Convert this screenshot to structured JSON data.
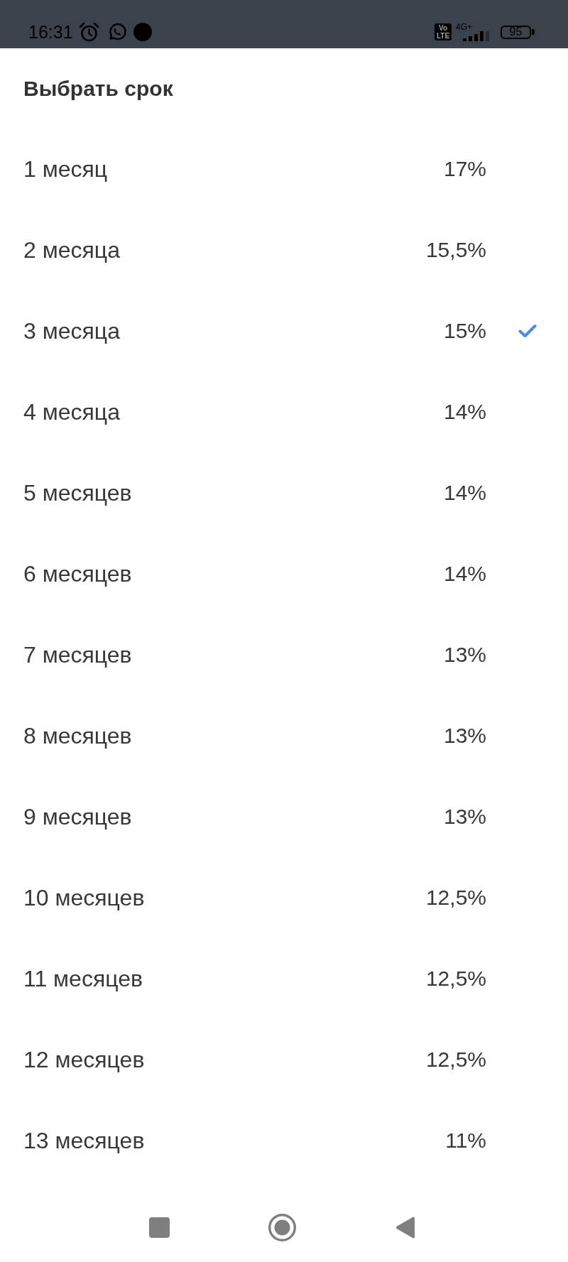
{
  "status_bar": {
    "time": "16:31",
    "volte_badge": "Vo LTE",
    "network_type": "4G+",
    "battery": "95"
  },
  "dialog": {
    "title": "Выбрать срок",
    "options": [
      {
        "label": "1 месяц",
        "rate": "17%",
        "selected": false
      },
      {
        "label": "2 месяца",
        "rate": "15,5%",
        "selected": false
      },
      {
        "label": "3 месяца",
        "rate": "15%",
        "selected": true
      },
      {
        "label": "4 месяца",
        "rate": "14%",
        "selected": false
      },
      {
        "label": "5 месяцев",
        "rate": "14%",
        "selected": false
      },
      {
        "label": "6 месяцев",
        "rate": "14%",
        "selected": false
      },
      {
        "label": "7 месяцев",
        "rate": "13%",
        "selected": false
      },
      {
        "label": "8 месяцев",
        "rate": "13%",
        "selected": false
      },
      {
        "label": "9 месяцев",
        "rate": "13%",
        "selected": false
      },
      {
        "label": "10 месяцев",
        "rate": "12,5%",
        "selected": false
      },
      {
        "label": "11 месяцев",
        "rate": "12,5%",
        "selected": false
      },
      {
        "label": "12 месяцев",
        "rate": "12,5%",
        "selected": false
      },
      {
        "label": "13 месяцев",
        "rate": "11%",
        "selected": false
      }
    ]
  }
}
